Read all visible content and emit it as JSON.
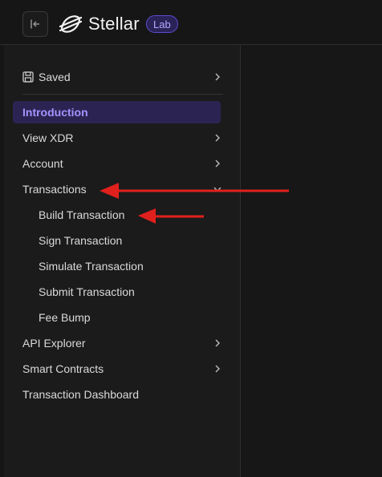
{
  "header": {
    "brand": "Stellar",
    "badge": "Lab"
  },
  "sidebar": {
    "saved_label": "Saved",
    "items": [
      {
        "label": "Introduction",
        "active": true
      },
      {
        "label": "View XDR"
      },
      {
        "label": "Account"
      },
      {
        "label": "Transactions",
        "expanded": true
      },
      {
        "label": "Build Transaction",
        "sub": true
      },
      {
        "label": "Sign Transaction",
        "sub": true
      },
      {
        "label": "Simulate Transaction",
        "sub": true
      },
      {
        "label": "Submit Transaction",
        "sub": true
      },
      {
        "label": "Fee Bump",
        "sub": true
      },
      {
        "label": "API Explorer"
      },
      {
        "label": "Smart Contracts"
      },
      {
        "label": "Transaction Dashboard"
      }
    ]
  },
  "colors": {
    "accent": "#a692ff",
    "active_bg": "#2b2452",
    "annotation_arrow": "#e0201d"
  }
}
